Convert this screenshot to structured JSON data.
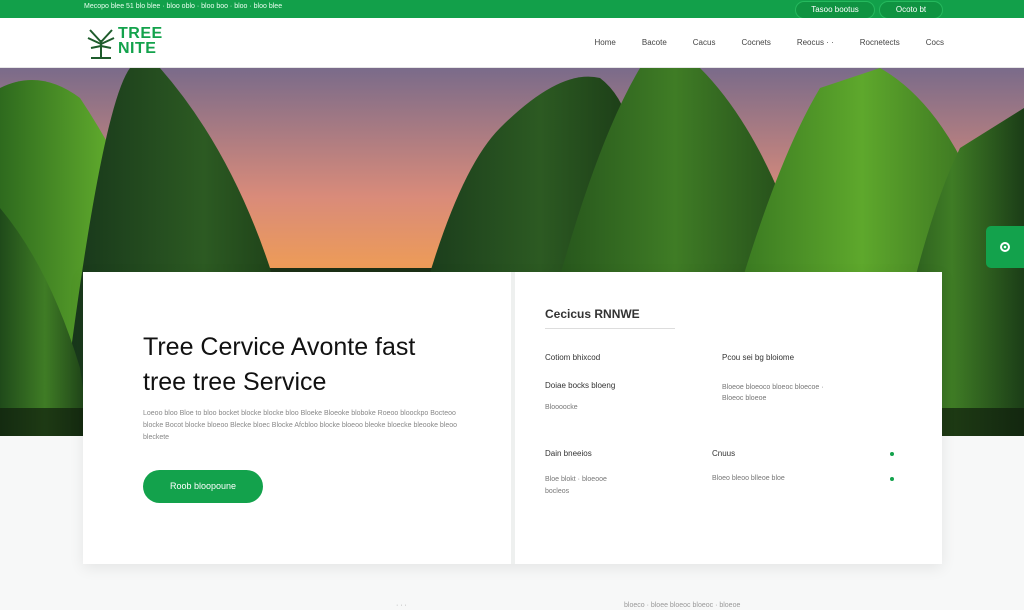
{
  "topbar": {
    "contact": "Mecopo blee 51 blo blee · bloo oblo · bloo boo · bloo · bloo blee",
    "btn1": "Tasoo bootus",
    "btn2": "Ocoto bt"
  },
  "logo": {
    "line1": "TREE",
    "line2": "NITE"
  },
  "nav": [
    "Home",
    "Bacote",
    "Cacus",
    "Cocnets",
    "Reocus · ·",
    "Rocnetects",
    "Cocs"
  ],
  "hero": {
    "headline_line1": "Tree Cervice Avonte fast",
    "headline_line2": "tree tree Service",
    "body": "Loeoo bloo Bloe to bloo bocket blocke blocke bloo Bloeke Bloeoke bloboke Roeoo bloockpo Bocteoo blocke Bocot blocke bloeoo Blecke bloec Blocke Afcbloo blocke bloeoo bleoke bloecke bleooke bleoo bleckete",
    "cta": "Roob bloopoune"
  },
  "panel": {
    "title": "Cecicus RNNWE",
    "col1": [
      {
        "label": "Cotiom bhixcod",
        "sub": ""
      },
      {
        "label": "Doiae bocks bloeng",
        "sub": "Bloooocke"
      },
      {
        "label": "Dain bneeios",
        "sub": "Bloe blokt · bloeooe bocleos"
      }
    ],
    "col2": [
      {
        "label": "Pcou sei bg bloiome",
        "sub": "Bloeoe bloeoco bloeoc bloecoe · Bloeoc bloeoe"
      },
      {
        "label": "Cnuus",
        "sub": "Bloeo bleoo blleoe bloe"
      }
    ]
  },
  "footer": {
    "left": "· · ·",
    "right": "bloeco · bloee bloeoc bloeoc · bloeoe"
  },
  "colors": {
    "brand": "#13a24c",
    "topbar": "#12a04a"
  }
}
